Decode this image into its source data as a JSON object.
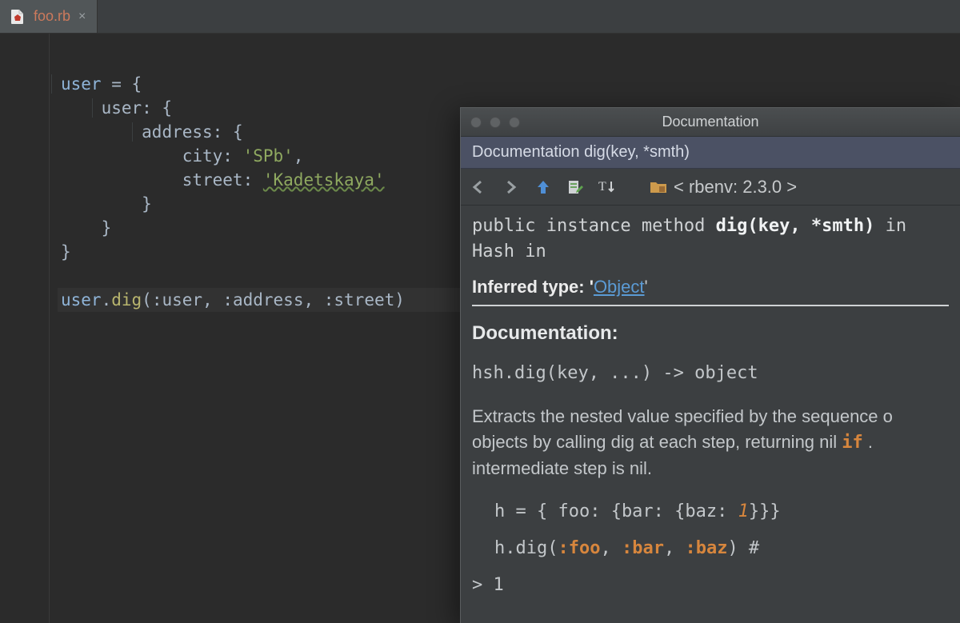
{
  "tab": {
    "filename": "foo.rb",
    "close_glyph": "×"
  },
  "code": {
    "l1_var": "user",
    "l1_eq": " = {",
    "l2": "user: {",
    "l3": "address: {",
    "l4_key": "city: ",
    "l4_val": "'SPb'",
    "l4_tail": ",",
    "l5_key": "street: ",
    "l5_val": "'Kadetskaya'",
    "l6": "}",
    "l7": "}",
    "l8": "}",
    "call_obj": "user",
    "call_dot": ".",
    "call_m": "dig",
    "call_args": "(:user, :address, :street)"
  },
  "doc": {
    "window_title": "Documentation",
    "subtitle": "Documentation dig(key, *smth)",
    "env_label": "< rbenv: 2.3.0 >",
    "sig_pre": "public instance method ",
    "sig_bold": "dig(key, *smth)",
    "sig_post": " in Hash  in",
    "inferred_pre": "Inferred type: '",
    "inferred_link": "Object",
    "inferred_post": "'",
    "doc_heading": "Documentation:",
    "syntax_line": "hsh.dig(key, ...) -> object",
    "para_a": "Extracts the nested value specified by the sequence o",
    "para_b": "objects by calling dig at each step, returning nil ",
    "para_b_kw": "if",
    "para_b_tail": " .",
    "para_c": "intermediate step is nil.",
    "ex1_pre": "h = { foo: {bar: {baz: ",
    "ex1_num": "1",
    "ex1_post": "}}}",
    "ex2_pre": "h.dig(",
    "ex2_a": ":foo",
    "ex2_sep": ", ",
    "ex2_b": ":bar",
    "ex2_c": ":baz",
    "ex2_post": ") #",
    "prompt": "> 1"
  }
}
